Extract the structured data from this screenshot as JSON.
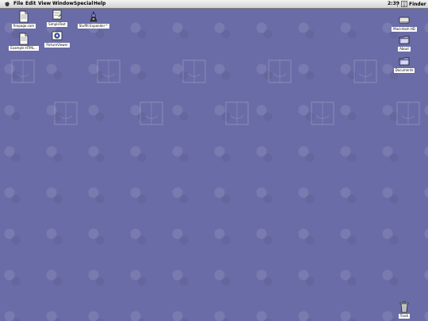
{
  "menubar": {
    "items": [
      "File",
      "Edit",
      "View",
      "Window",
      "Special",
      "Help"
    ],
    "clock": "2:39",
    "app": "Finder",
    "apple_icon": "apple-logo-icon",
    "finder_icon": "finder-face-icon"
  },
  "desktop": {
    "background_color": "#6a6ca7",
    "icons": {
      "firepage": "firepage.com",
      "example": "Example HTML...",
      "simpletext": "SimpleText",
      "pictureviewer": "PictureViewer",
      "stuffit": "StuffIt Expander™",
      "macintoshhd": "Macintosh HD",
      "about": "About",
      "documents": "Documents",
      "trash": "Trash"
    }
  }
}
